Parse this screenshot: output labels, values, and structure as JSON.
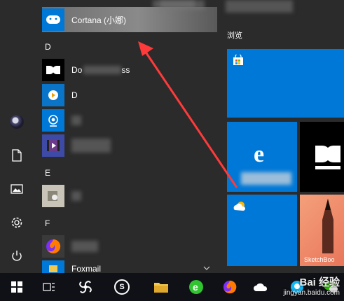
{
  "applist": {
    "cortana_label": "Cortana (小娜)",
    "groups": [
      "D",
      "E",
      "F"
    ],
    "dolby_label": "Do",
    "dolby_tail": "ss",
    "d_label": "D",
    "fox_label": "Foxmail"
  },
  "tiles": {
    "header": "浏览",
    "edge_label": "e",
    "sketchbook_label": "SketchBoo"
  },
  "watermark": {
    "main": "Bai 经验",
    "url": "jingyan.baidu.com"
  },
  "colors": {
    "accent": "#0078d7",
    "arrow": "#ff3a3a",
    "taskbar": "#0f1117"
  }
}
